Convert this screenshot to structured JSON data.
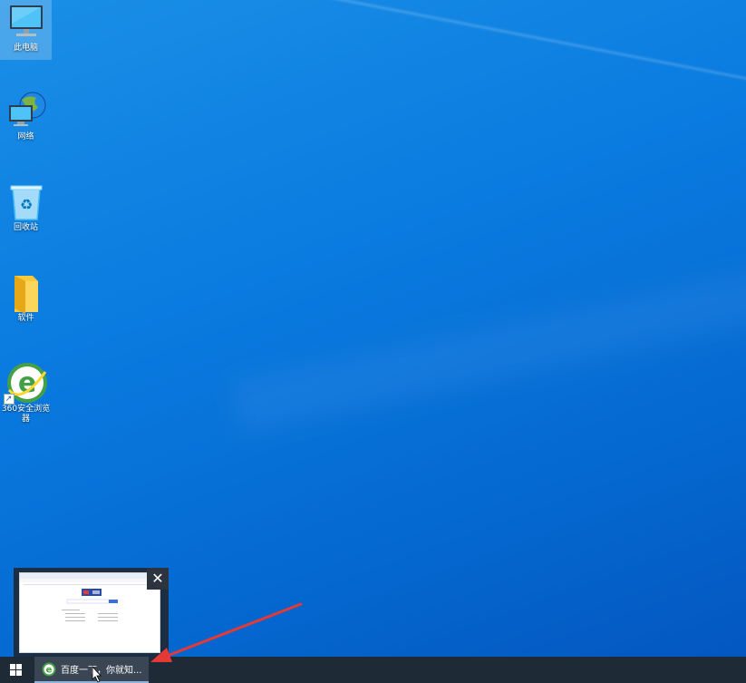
{
  "desktop": {
    "icons": [
      {
        "label": "此电脑",
        "icon": "computer-icon",
        "selected": true
      },
      {
        "label": "网络",
        "icon": "network-icon",
        "selected": false
      },
      {
        "label": "回收站",
        "icon": "recycle-bin-icon",
        "selected": false
      },
      {
        "label": "软件",
        "icon": "folder-icon",
        "selected": false
      },
      {
        "label": "360安全浏览器",
        "icon": "360-browser-icon",
        "selected": false,
        "shortcut": true
      }
    ]
  },
  "thumbnail": {
    "close_label": "✕"
  },
  "taskbar": {
    "start_icon": "windows-logo-icon",
    "task_item": {
      "label": "百度一下，你就知...",
      "icon": "360-browser-icon"
    }
  },
  "annotation": {
    "arrow_color": "#e53935"
  }
}
